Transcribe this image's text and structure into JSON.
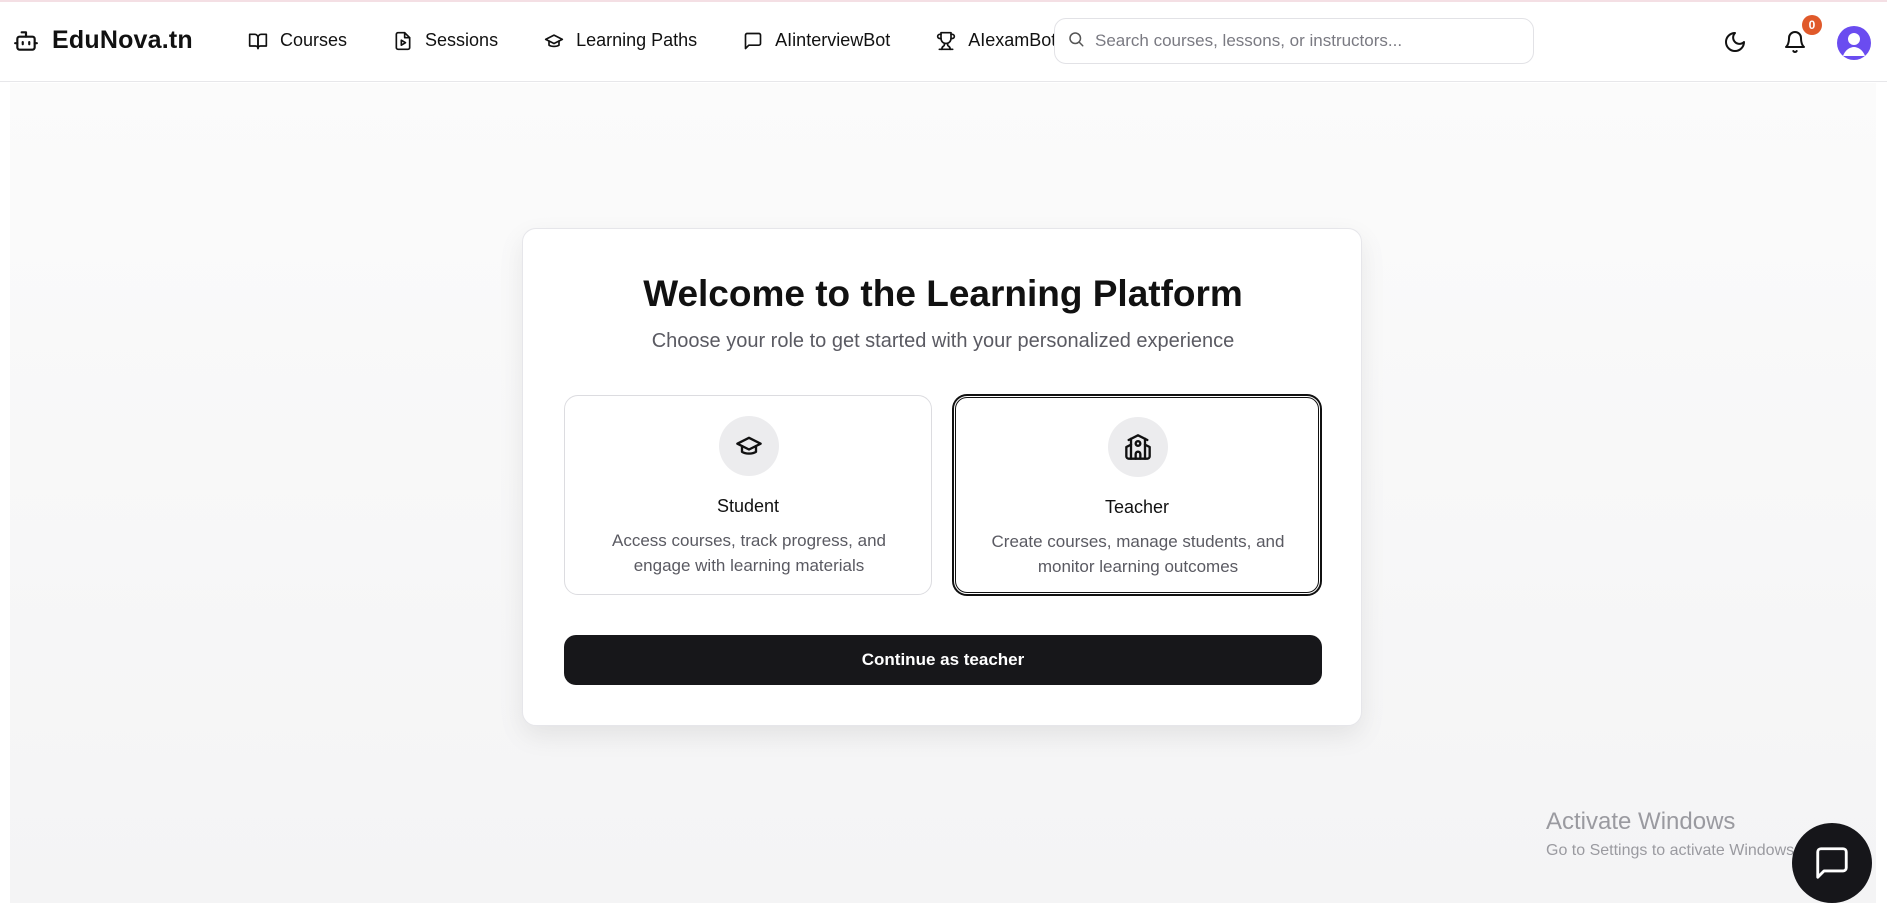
{
  "brand": {
    "name": "EduNova.tn",
    "logo_icon": "bot-icon"
  },
  "nav": [
    {
      "label": "Courses",
      "icon": "book-open-icon"
    },
    {
      "label": "Sessions",
      "icon": "file-play-icon"
    },
    {
      "label": "Learning Paths",
      "icon": "graduation-cap-icon"
    },
    {
      "label": "AIinterviewBot",
      "icon": "message-square-icon"
    },
    {
      "label": "AIexamBot",
      "icon": "trophy-icon"
    }
  ],
  "search": {
    "placeholder": "Search courses, lessons, or instructors...",
    "value": ""
  },
  "header": {
    "notification_count": "0",
    "accent_color": "#6a4cf0",
    "badge_color": "#e0592a"
  },
  "main": {
    "title": "Welcome to the Learning Platform",
    "subtitle": "Choose your role to get started with your personalized experience",
    "roles": [
      {
        "title": "Student",
        "description": "Access courses, track progress, and engage with learning materials",
        "icon": "graduation-cap-icon",
        "selected": false
      },
      {
        "title": "Teacher",
        "description": "Create courses, manage students, and monitor learning outcomes",
        "icon": "school-icon",
        "selected": true
      }
    ],
    "continue_label": "Continue as teacher"
  },
  "watermark": {
    "line1": "Activate Windows",
    "line2": "Go to Settings to activate Windows."
  }
}
